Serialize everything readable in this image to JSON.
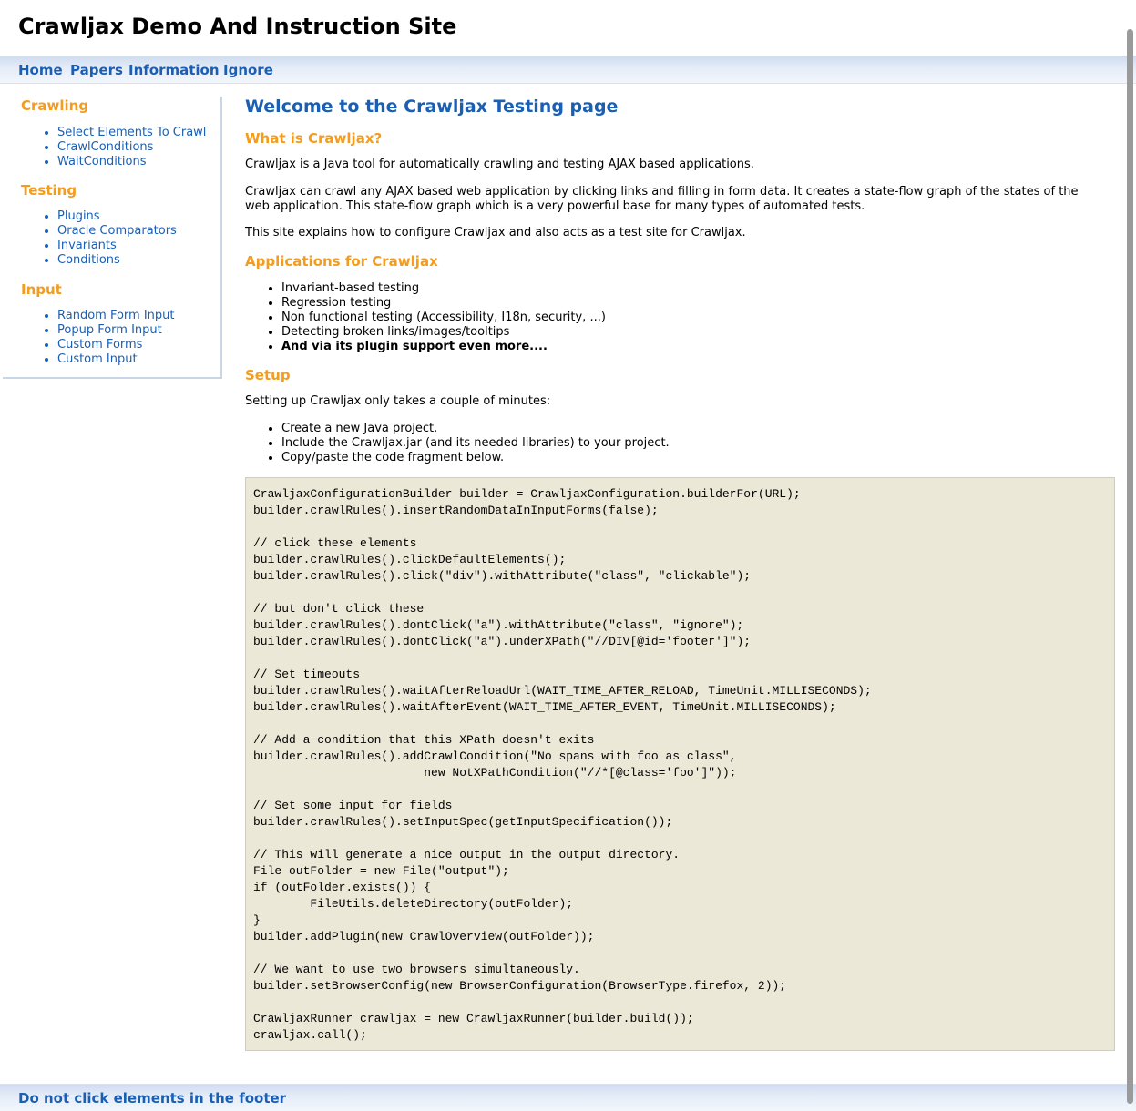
{
  "header": {
    "title": "Crawljax Demo And Instruction Site"
  },
  "nav": {
    "items": [
      {
        "label": "Home"
      },
      {
        "label": "Papers"
      },
      {
        "label": "Information"
      },
      {
        "label": "Ignore"
      }
    ]
  },
  "sidebar": {
    "sections": [
      {
        "heading": "Crawling",
        "links": [
          "Select Elements To Crawl",
          "CrawlConditions",
          "WaitConditions"
        ]
      },
      {
        "heading": "Testing",
        "links": [
          "Plugins",
          "Oracle Comparators",
          "Invariants",
          "Conditions"
        ]
      },
      {
        "heading": "Input",
        "links": [
          "Random Form Input",
          "Popup Form Input",
          "Custom Forms",
          "Custom Input"
        ]
      }
    ]
  },
  "main": {
    "title": "Welcome to the Crawljax Testing page",
    "what_heading": "What is Crawljax?",
    "what_p1": "Crawljax is a Java tool for automatically crawling and testing AJAX based applications.",
    "what_p2": "Crawljax can crawl any AJAX based web application by clicking links and filling in form data. It creates a state-flow graph of the states of the web application. This state-flow graph which is a very powerful base for many types of automated tests.",
    "what_p3": "This site explains how to configure Crawljax and also acts as a test site for Crawljax.",
    "apps_heading": "Applications for Crawljax",
    "apps": [
      "Invariant-based testing",
      "Regression testing",
      "Non functional testing (Accessibility, I18n, security, ...)",
      "Detecting broken links/images/tooltips",
      "And via its plugin support even more...."
    ],
    "setup_heading": "Setup",
    "setup_intro": "Setting up Crawljax only takes a couple of minutes:",
    "setup_steps": [
      "Create a new Java project.",
      "Include the Crawljax.jar (and its needed libraries) to your project.",
      "Copy/paste the code fragment below."
    ],
    "code": "CrawljaxConfigurationBuilder builder = CrawljaxConfiguration.builderFor(URL);\nbuilder.crawlRules().insertRandomDataInInputForms(false);\n\n// click these elements\nbuilder.crawlRules().clickDefaultElements();\nbuilder.crawlRules().click(\"div\").withAttribute(\"class\", \"clickable\");\n\n// but don't click these\nbuilder.crawlRules().dontClick(\"a\").withAttribute(\"class\", \"ignore\");\nbuilder.crawlRules().dontClick(\"a\").underXPath(\"//DIV[@id='footer']\");\n\n// Set timeouts\nbuilder.crawlRules().waitAfterReloadUrl(WAIT_TIME_AFTER_RELOAD, TimeUnit.MILLISECONDS);\nbuilder.crawlRules().waitAfterEvent(WAIT_TIME_AFTER_EVENT, TimeUnit.MILLISECONDS);\n\n// Add a condition that this XPath doesn't exits\nbuilder.crawlRules().addCrawlCondition(\"No spans with foo as class\",\n                        new NotXPathCondition(\"//*[@class='foo']\"));\n\n// Set some input for fields\nbuilder.crawlRules().setInputSpec(getInputSpecification());\n\n// This will generate a nice output in the output directory.\nFile outFolder = new File(\"output\");\nif (outFolder.exists()) {\n        FileUtils.deleteDirectory(outFolder);\n}\nbuilder.addPlugin(new CrawlOverview(outFolder));\n\n// We want to use two browsers simultaneously.\nbuilder.setBrowserConfig(new BrowserConfiguration(BrowserType.firefox, 2));\n\nCrawljaxRunner crawljax = new CrawljaxRunner(builder.build());\ncrawljax.call();"
  },
  "footer": {
    "link": "Do not click elements in the footer"
  },
  "colors": {
    "link_blue": "#1a5fb4",
    "heading_orange": "#f39c1e",
    "code_bg": "#ebe8d8"
  }
}
